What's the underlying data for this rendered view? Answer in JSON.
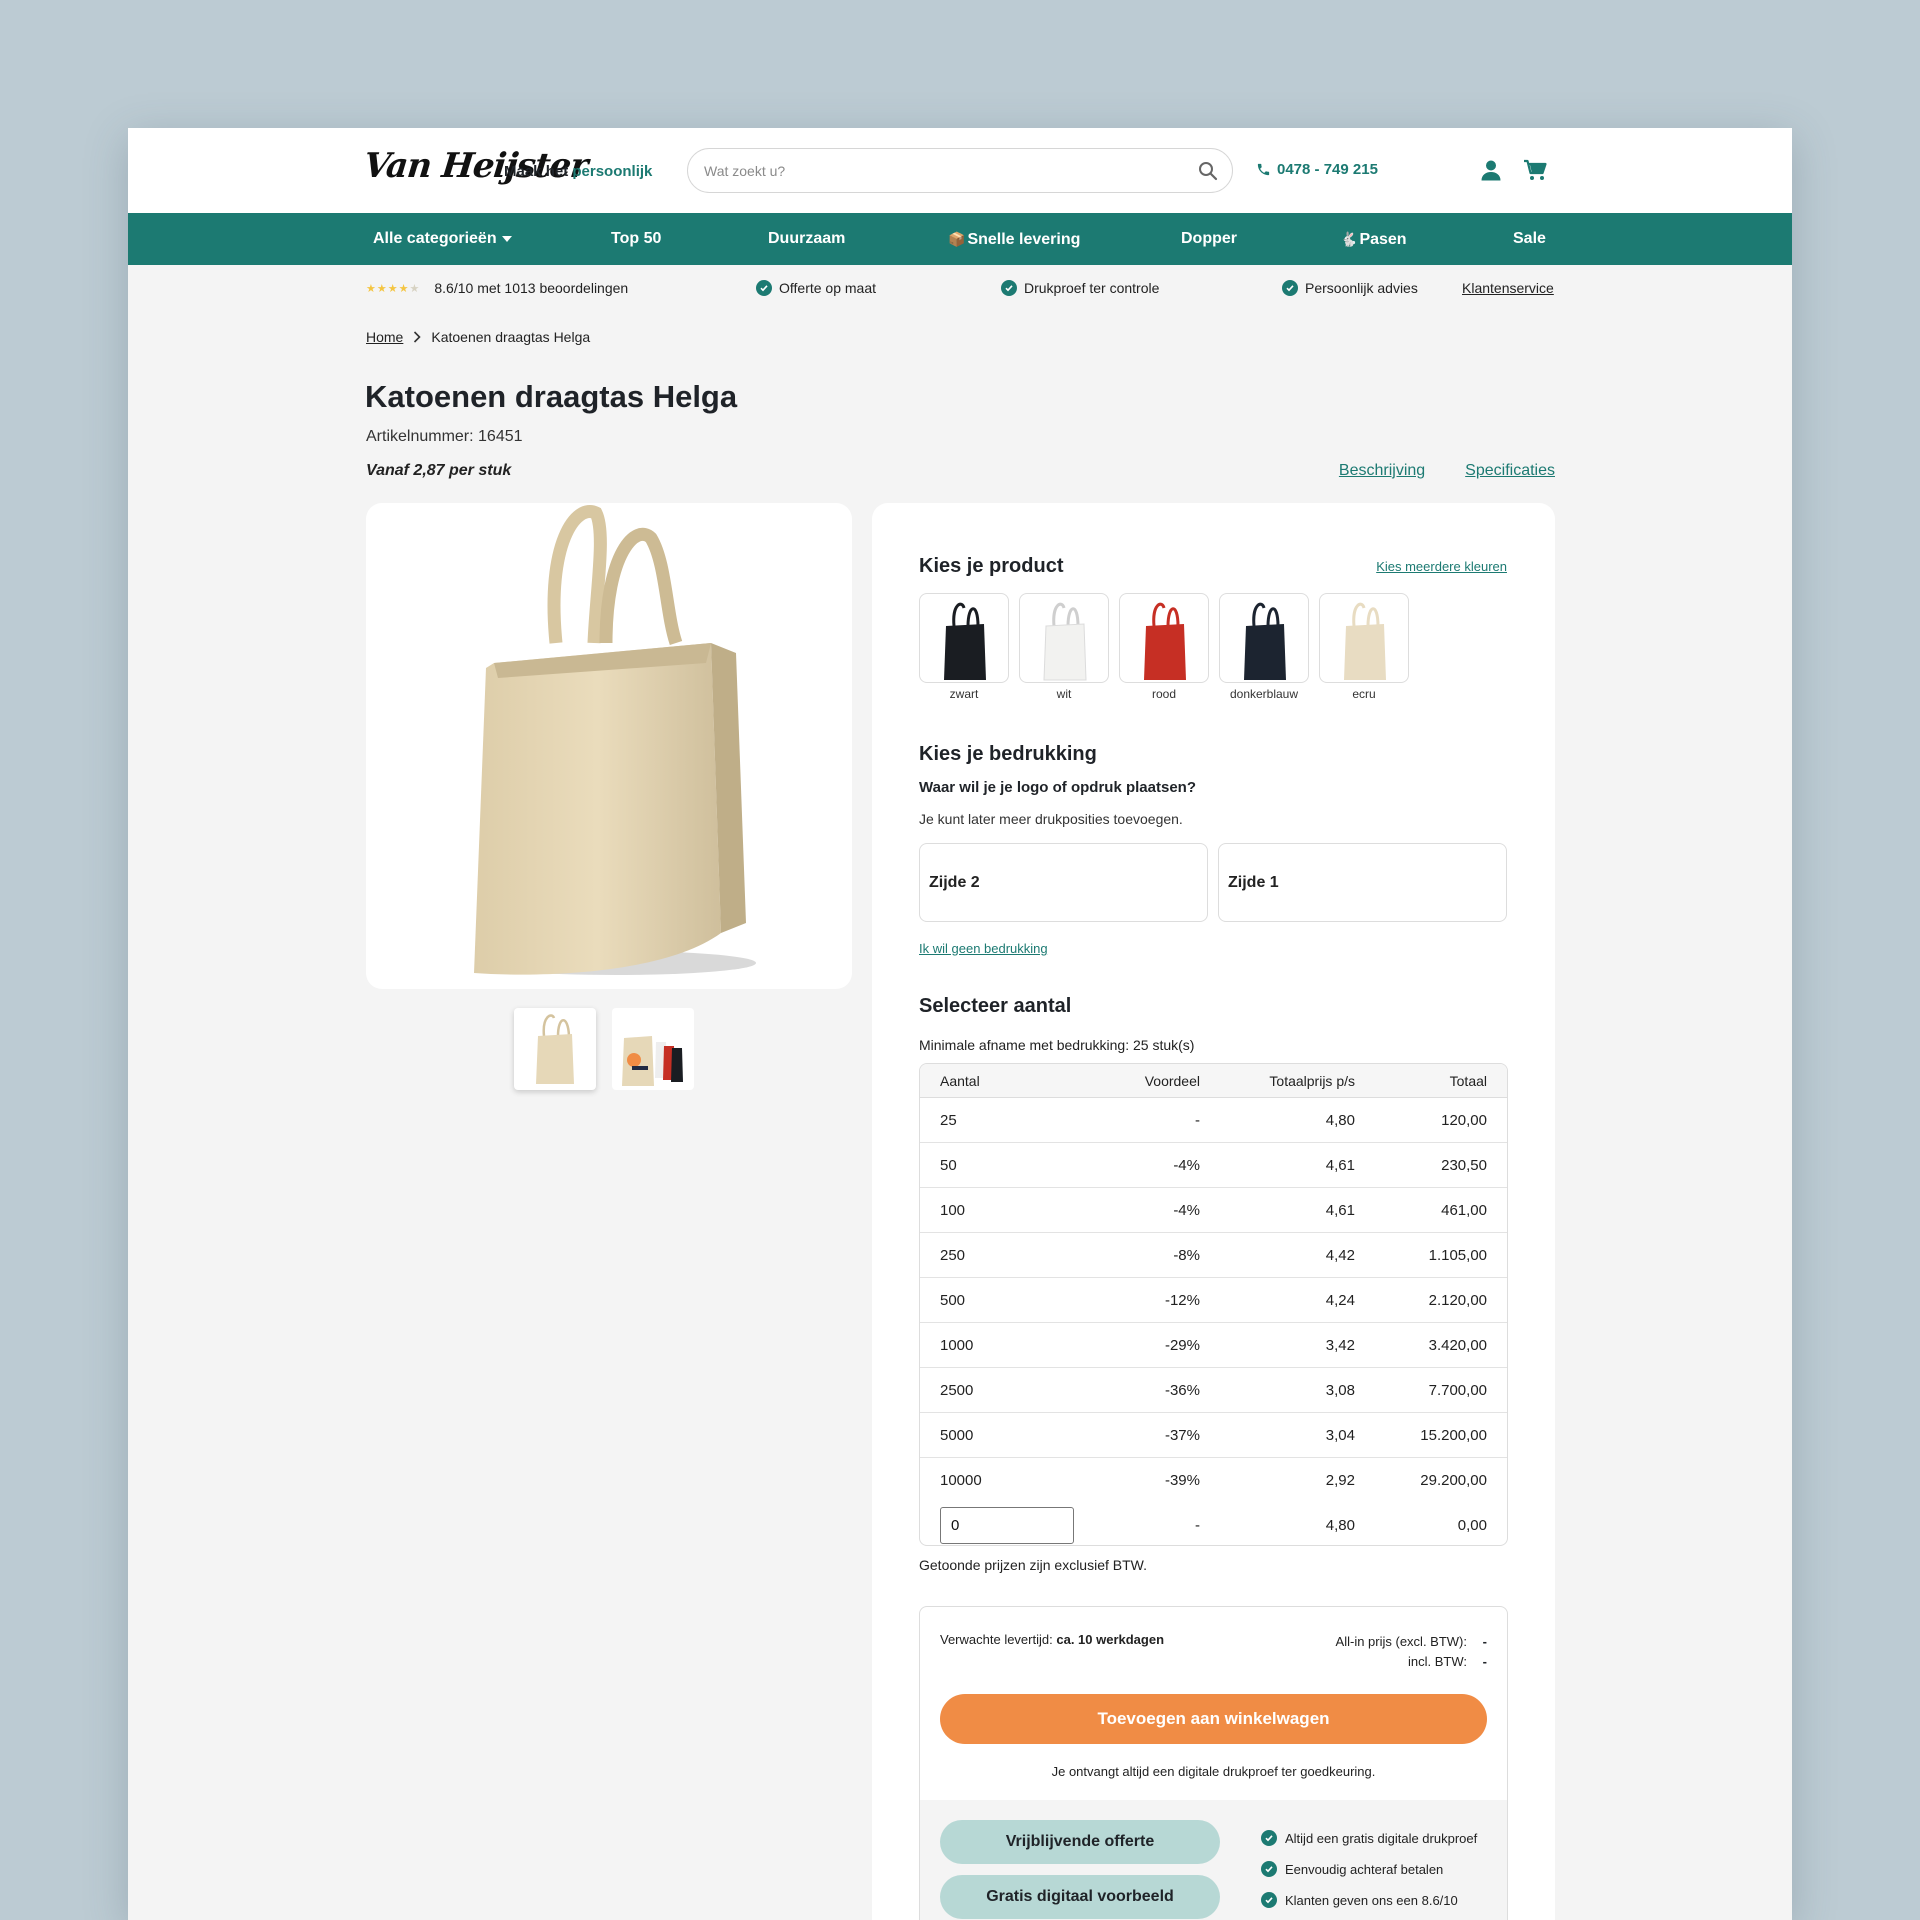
{
  "brand": {
    "logo_text": "Van Heijster",
    "tagline_prefix": "Maak het",
    "tagline_accent": "persoonlijk",
    "accent_color": "#1c7a72",
    "cta_color": "#f08c45"
  },
  "search": {
    "placeholder": "Wat zoekt u?"
  },
  "phone": "0478 - 749 215",
  "nav": {
    "items": [
      "Alle categorieën",
      "Top 50",
      "Duurzaam",
      "Snelle levering",
      "Dopper",
      "Pasen",
      "Sale"
    ]
  },
  "usp": {
    "rating": {
      "stars": 4,
      "text": "8.6/10 met 1013 beoordelingen"
    },
    "items": [
      "Offerte op maat",
      "Drukproef ter controle",
      "Persoonlijk advies"
    ],
    "service_link": "Klantenservice"
  },
  "breadcrumb": {
    "home": "Home",
    "current": "Katoenen draagtas Helga"
  },
  "product": {
    "title": "Katoenen draagtas Helga",
    "article_number": "Artikelnummer: 16451",
    "price_from": "Vanaf 2,87 per stuk",
    "links": [
      "Beschrijving",
      "Specificaties"
    ]
  },
  "config": {
    "choose_product": "Kies je product",
    "multi_color_link": "Kies meerdere kleuren",
    "colors": [
      {
        "label": "zwart",
        "hex": "#1a1d22"
      },
      {
        "label": "wit",
        "hex": "#f2f2f0"
      },
      {
        "label": "rood",
        "hex": "#c62f24"
      },
      {
        "label": "donkerblauw",
        "hex": "#1c2430"
      },
      {
        "label": "ecru",
        "hex": "#e8dcc2"
      }
    ],
    "choose_print": "Kies je bedrukking",
    "print_question": "Waar wil je je logo of opdruk plaatsen?",
    "print_hint": "Je kunt later meer drukposities toevoegen.",
    "sides": [
      "Zijde 2",
      "Zijde 1"
    ],
    "no_print_link": "Ik wil geen bedrukking",
    "select_qty": "Selecteer aantal",
    "min_order": "Minimale afname met bedrukking: 25 stuk(s)",
    "table_headers": [
      "Aantal",
      "Voordeel",
      "Totaalprijs p/s",
      "Totaal"
    ],
    "rows": [
      [
        "25",
        "-",
        "4,80",
        "120,00"
      ],
      [
        "50",
        "-4%",
        "4,61",
        "230,50"
      ],
      [
        "100",
        "-4%",
        "4,61",
        "461,00"
      ],
      [
        "250",
        "-8%",
        "4,42",
        "1.105,00"
      ],
      [
        "500",
        "-12%",
        "4,24",
        "2.120,00"
      ],
      [
        "1000",
        "-29%",
        "3,42",
        "3.420,00"
      ],
      [
        "2500",
        "-36%",
        "3,08",
        "7.700,00"
      ],
      [
        "5000",
        "-37%",
        "3,04",
        "15.200,00"
      ],
      [
        "10000",
        "-39%",
        "2,92",
        "29.200,00"
      ]
    ],
    "custom_row": {
      "qty": "0",
      "discount": "-",
      "unit": "4,80",
      "total": "0,00"
    },
    "btw_note": "Getoonde prijzen zijn exclusief BTW."
  },
  "order": {
    "delivery_label": "Verwachte levertijd:",
    "delivery_value": "ca. 10 werkdagen",
    "allin_label": "All-in prijs (excl. BTW):",
    "incl_label": "incl. BTW:",
    "allin_value": "-",
    "incl_value": "-",
    "cart_button": "Toevoegen aan winkelwagen",
    "proof_note": "Je ontvangt altijd een digitale drukproef ter goedkeuring.",
    "quote_button": "Vrijblijvende offerte",
    "preview_button": "Gratis digitaal voorbeeld",
    "perks": [
      "Altijd een gratis digitale drukproef",
      "Eenvoudig achteraf betalen",
      "Klanten geven ons een 8.6/10"
    ]
  }
}
